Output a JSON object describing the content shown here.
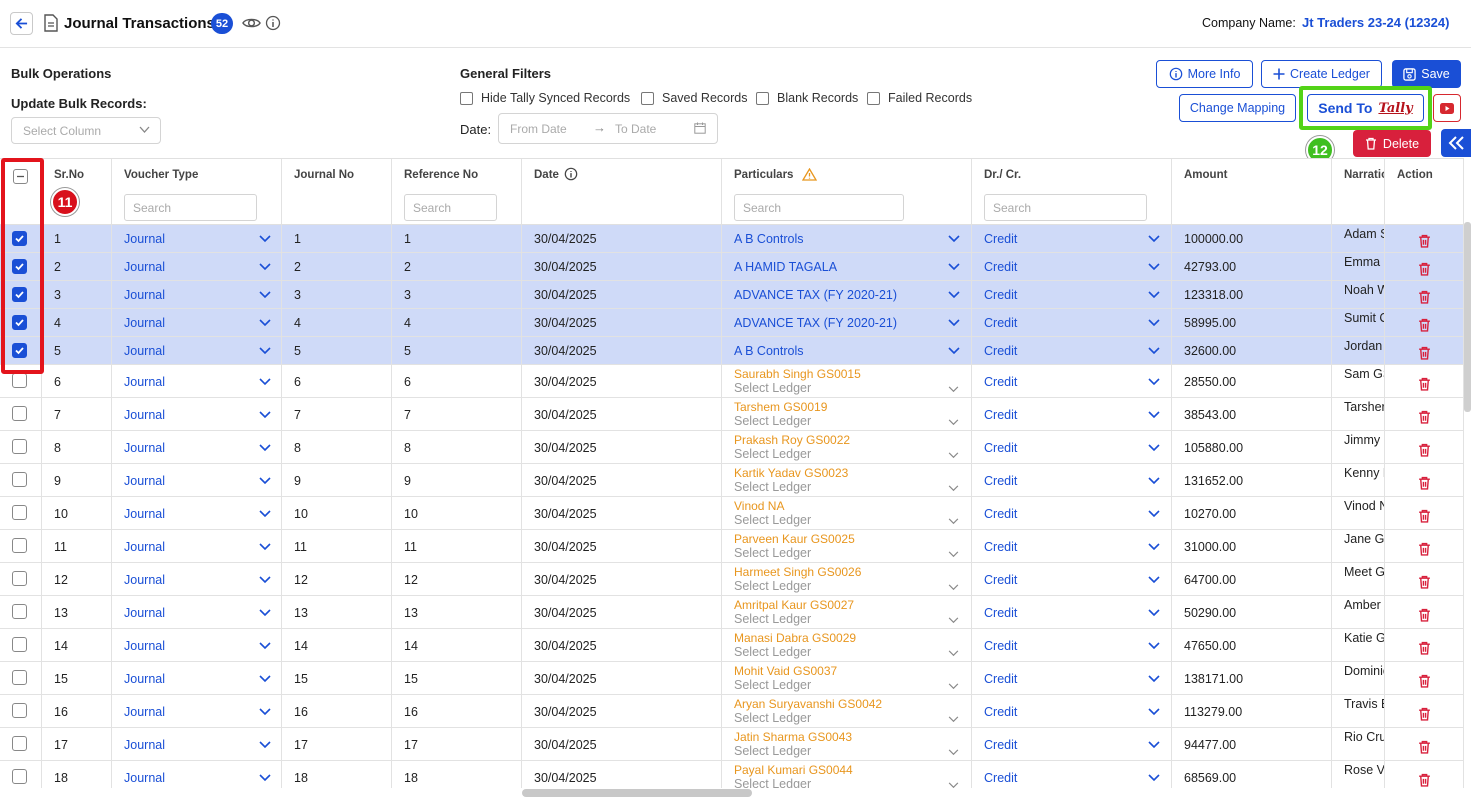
{
  "header": {
    "title": "Journal Transactions",
    "count": "52",
    "company_label": "Company Name:",
    "company_name": "Jt Traders 23-24 (12324)"
  },
  "bulk": {
    "title": "Bulk Operations",
    "update_label": "Update Bulk Records:",
    "select_placeholder": "Select Column"
  },
  "filters": {
    "title": "General Filters",
    "checkboxes": [
      "Hide Tally Synced Records",
      "Saved Records",
      "Blank Records",
      "Failed Records"
    ],
    "date_label": "Date:",
    "from_placeholder": "From Date",
    "to_placeholder": "To Date"
  },
  "actions": {
    "more_info": "More Info",
    "create_ledger": "Create Ledger",
    "save": "Save",
    "change_mapping": "Change Mapping",
    "send_to": "Send To",
    "tally_logo": "Tally",
    "delete": "Delete"
  },
  "steps": {
    "select_all": "11",
    "send": "12"
  },
  "columns": {
    "srno": "Sr.No",
    "voucher_type": "Voucher Type",
    "journal_no": "Journal No",
    "reference_no": "Reference No",
    "date": "Date",
    "particulars": "Particulars",
    "drcr": "Dr./ Cr.",
    "amount": "Amount",
    "narration": "Narratio",
    "action": "Action",
    "search_placeholder": "Search"
  },
  "rows": [
    {
      "sr": "1",
      "voucher": "Journal",
      "journal": "1",
      "ref": "1",
      "date": "30/04/2025",
      "particular": "A B Controls",
      "suggest": "",
      "drcr": "Credit",
      "amount": "100000.00",
      "narration": "Adam S",
      "selected": true
    },
    {
      "sr": "2",
      "voucher": "Journal",
      "journal": "2",
      "ref": "2",
      "date": "30/04/2025",
      "particular": "A HAMID TAGALA",
      "suggest": "",
      "drcr": "Credit",
      "amount": "42793.00",
      "narration": "Emma S",
      "selected": true
    },
    {
      "sr": "3",
      "voucher": "Journal",
      "journal": "3",
      "ref": "3",
      "date": "30/04/2025",
      "particular": "ADVANCE TAX (FY 2020-21)",
      "suggest": "",
      "drcr": "Credit",
      "amount": "123318.00",
      "narration": "Noah W",
      "selected": true
    },
    {
      "sr": "4",
      "voucher": "Journal",
      "journal": "4",
      "ref": "4",
      "date": "30/04/2025",
      "particular": "ADVANCE TAX (FY 2020-21)",
      "suggest": "",
      "drcr": "Credit",
      "amount": "58995.00",
      "narration": "Sumit C",
      "selected": true
    },
    {
      "sr": "5",
      "voucher": "Journal",
      "journal": "5",
      "ref": "5",
      "date": "30/04/2025",
      "particular": "A B Controls",
      "suggest": "",
      "drcr": "Credit",
      "amount": "32600.00",
      "narration": "Jordan",
      "selected": true
    },
    {
      "sr": "6",
      "voucher": "Journal",
      "journal": "6",
      "ref": "6",
      "date": "30/04/2025",
      "particular": "Select Ledger",
      "suggest": "Saurabh Singh GS0015",
      "drcr": "Credit",
      "amount": "28550.00",
      "narration": "Sam GS",
      "selected": false
    },
    {
      "sr": "7",
      "voucher": "Journal",
      "journal": "7",
      "ref": "7",
      "date": "30/04/2025",
      "particular": "Select Ledger",
      "suggest": "Tarshem GS0019",
      "drcr": "Credit",
      "amount": "38543.00",
      "narration": "Tarsher",
      "selected": false
    },
    {
      "sr": "8",
      "voucher": "Journal",
      "journal": "8",
      "ref": "8",
      "date": "30/04/2025",
      "particular": "Select Ledger",
      "suggest": "Prakash Roy GS0022",
      "drcr": "Credit",
      "amount": "105880.00",
      "narration": "Jimmy",
      "selected": false
    },
    {
      "sr": "9",
      "voucher": "Journal",
      "journal": "9",
      "ref": "9",
      "date": "30/04/2025",
      "particular": "Select Ledger",
      "suggest": "Kartik Yadav GS0023",
      "drcr": "Credit",
      "amount": "131652.00",
      "narration": "Kenny N",
      "selected": false
    },
    {
      "sr": "10",
      "voucher": "Journal",
      "journal": "10",
      "ref": "10",
      "date": "30/04/2025",
      "particular": "Select Ledger",
      "suggest": "Vinod NA",
      "drcr": "Credit",
      "amount": "10270.00",
      "narration": "Vinod N",
      "selected": false
    },
    {
      "sr": "11",
      "voucher": "Journal",
      "journal": "11",
      "ref": "11",
      "date": "30/04/2025",
      "particular": "Select Ledger",
      "suggest": "Parveen Kaur GS0025",
      "drcr": "Credit",
      "amount": "31000.00",
      "narration": "Jane G",
      "selected": false
    },
    {
      "sr": "12",
      "voucher": "Journal",
      "journal": "12",
      "ref": "12",
      "date": "30/04/2025",
      "particular": "Select Ledger",
      "suggest": "Harmeet Singh GS0026",
      "drcr": "Credit",
      "amount": "64700.00",
      "narration": "Meet G",
      "selected": false
    },
    {
      "sr": "13",
      "voucher": "Journal",
      "journal": "13",
      "ref": "13",
      "date": "30/04/2025",
      "particular": "Select Ledger",
      "suggest": "Amritpal Kaur GS0027",
      "drcr": "Credit",
      "amount": "50290.00",
      "narration": "Amber",
      "selected": false
    },
    {
      "sr": "14",
      "voucher": "Journal",
      "journal": "14",
      "ref": "14",
      "date": "30/04/2025",
      "particular": "Select Ledger",
      "suggest": "Manasi Dabra GS0029",
      "drcr": "Credit",
      "amount": "47650.00",
      "narration": "Katie G",
      "selected": false
    },
    {
      "sr": "15",
      "voucher": "Journal",
      "journal": "15",
      "ref": "15",
      "date": "30/04/2025",
      "particular": "Select Ledger",
      "suggest": "Mohit Vaid GS0037",
      "drcr": "Credit",
      "amount": "138171.00",
      "narration": "Dominic",
      "selected": false
    },
    {
      "sr": "16",
      "voucher": "Journal",
      "journal": "16",
      "ref": "16",
      "date": "30/04/2025",
      "particular": "Select Ledger",
      "suggest": "Aryan Suryavanshi GS0042",
      "drcr": "Credit",
      "amount": "113279.00",
      "narration": "Travis E",
      "selected": false
    },
    {
      "sr": "17",
      "voucher": "Journal",
      "journal": "17",
      "ref": "17",
      "date": "30/04/2025",
      "particular": "Select Ledger",
      "suggest": "Jatin Sharma GS0043",
      "drcr": "Credit",
      "amount": "94477.00",
      "narration": "Rio Cru",
      "selected": false
    },
    {
      "sr": "18",
      "voucher": "Journal",
      "journal": "18",
      "ref": "18",
      "date": "30/04/2025",
      "particular": "Select Ledger",
      "suggest": "Payal Kumari GS0044",
      "drcr": "Credit",
      "amount": "68569.00",
      "narration": "Rose Va",
      "selected": false
    }
  ],
  "colors": {
    "accent": "#1a4fd6",
    "selected_row": "#cfdaf8",
    "danger": "#d8203c",
    "suggest": "#e8961e",
    "highlight_green": "#52d317",
    "highlight_red": "#e3141c"
  },
  "icons": [
    "back-arrow-icon",
    "document-icon",
    "eye-icon",
    "info-icon",
    "chevron-down-icon",
    "calendar-icon",
    "plus-icon",
    "save-icon",
    "youtube-icon",
    "trash-icon",
    "double-chevron-left-icon",
    "warning-icon"
  ]
}
